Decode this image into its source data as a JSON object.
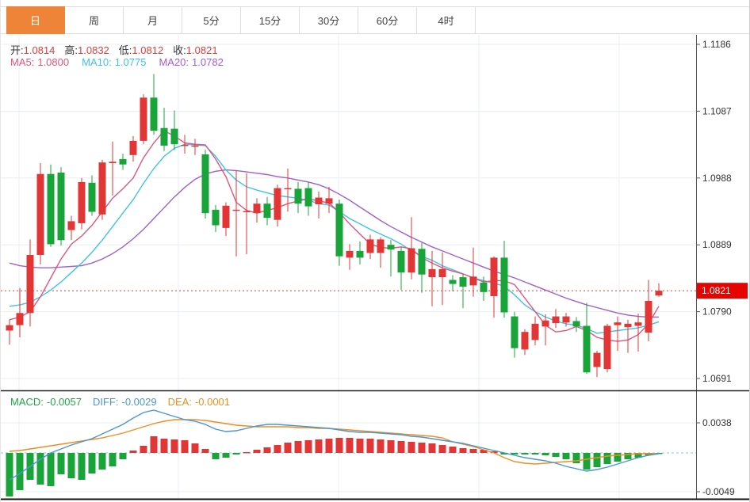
{
  "tabs": [
    {
      "key": "day",
      "label": "日",
      "active": true
    },
    {
      "key": "week",
      "label": "周",
      "active": false
    },
    {
      "key": "month",
      "label": "月",
      "active": false
    },
    {
      "key": "min5",
      "label": "5分",
      "active": false
    },
    {
      "key": "min15",
      "label": "15分",
      "active": false
    },
    {
      "key": "min30",
      "label": "30分",
      "active": false
    },
    {
      "key": "min60",
      "label": "60分",
      "active": false
    },
    {
      "key": "hour4",
      "label": "4时",
      "active": false
    }
  ],
  "legend": {
    "ohlc": [
      {
        "label": "开:",
        "value": "1.0814"
      },
      {
        "label": "高:",
        "value": "1.0832"
      },
      {
        "label": "低:",
        "value": "1.0812"
      },
      {
        "label": "收:",
        "value": "1.0821"
      }
    ],
    "ma": [
      {
        "label": "MA5:",
        "value": "1.0800"
      },
      {
        "label": "MA10:",
        "value": "1.0775"
      },
      {
        "label": "MA20:",
        "value": "1.0782"
      }
    ]
  },
  "macd_legend": [
    {
      "label": "MACD:",
      "value": "-0.0057"
    },
    {
      "label": "DIFF:",
      "value": "-0.0029"
    },
    {
      "label": "DEA:",
      "value": "-0.0001"
    }
  ],
  "colors": {
    "up": "#e23636",
    "down": "#18a438",
    "ma5": "#e0557e",
    "ma10": "#3ec3e8",
    "ma20": "#a35ecb",
    "diff": "#4a96d2",
    "dea": "#ef8d1f",
    "macd_value": "#22a447",
    "price_line": "#e13c39",
    "badge_bg": "#e60400",
    "tab_active_bg": "#ed8437",
    "grid": "#e9eef4",
    "axis_text": "#333333",
    "zero_line": "#90c5e8"
  },
  "chart_data": {
    "type": "candlestick",
    "title": "日线 K线图 (daily candlestick with MA5/MA10/MA20 and MACD)",
    "price_axis": {
      "ticks": [
        1.1186,
        1.1087,
        1.0988,
        1.0889,
        1.079,
        1.0691
      ],
      "range": [
        1.0691,
        1.1186
      ],
      "last_price": 1.0821
    },
    "candles": [
      [
        1.0762,
        1.0778,
        1.0741,
        1.077
      ],
      [
        1.077,
        1.0825,
        1.0752,
        1.0788
      ],
      [
        1.0788,
        1.0897,
        1.0768,
        1.0874
      ],
      [
        1.0874,
        1.101,
        1.086,
        1.0994
      ],
      [
        1.0994,
        1.1008,
        1.0886,
        1.089
      ],
      [
        1.0996,
        1.1004,
        1.0888,
        1.0896
      ],
      [
        1.0911,
        1.0932,
        1.0896,
        1.0924
      ],
      [
        1.0921,
        1.0988,
        1.0912,
        1.0982
      ],
      [
        1.0981,
        1.0992,
        1.0932,
        1.0938
      ],
      [
        1.0934,
        1.1015,
        1.0926,
        1.1011
      ],
      [
        1.101,
        1.1042,
        1.0962,
        1.1012
      ],
      [
        1.1016,
        1.1024,
        1.1,
        1.1008
      ],
      [
        1.1022,
        1.105,
        1.1012,
        1.1043
      ],
      [
        1.1043,
        1.1112,
        1.1038,
        1.1107
      ],
      [
        1.1107,
        1.1142,
        1.1052,
        1.1058
      ],
      [
        1.1062,
        1.1092,
        1.1028,
        1.1036
      ],
      [
        1.1061,
        1.1088,
        1.103,
        1.1038
      ],
      [
        1.1037,
        1.1052,
        1.1024,
        1.1037
      ],
      [
        1.1036,
        1.1046,
        1.1022,
        1.1036
      ],
      [
        1.1023,
        1.103,
        1.0928,
        1.0936
      ],
      [
        1.0941,
        1.0948,
        1.0908,
        1.0918
      ],
      [
        1.0914,
        1.0952,
        1.0902,
        1.0947
      ],
      [
        1.094,
        1.0999,
        1.0872,
        1.0941
      ],
      [
        1.0938,
        1.0995,
        1.0875,
        1.0939
      ],
      [
        1.0936,
        1.0958,
        1.0922,
        1.095
      ],
      [
        1.095,
        1.096,
        1.0918,
        1.0929
      ],
      [
        1.0926,
        1.0978,
        1.0916,
        1.0973
      ],
      [
        1.0972,
        1.1002,
        1.0938,
        1.0973
      ],
      [
        1.0972,
        1.0982,
        1.0936,
        1.095
      ],
      [
        1.0973,
        1.0982,
        1.0932,
        1.0946
      ],
      [
        1.0949,
        1.0968,
        1.0928,
        1.0959
      ],
      [
        1.095,
        1.0975,
        1.0936,
        1.0958
      ],
      [
        1.095,
        1.0956,
        1.0858,
        1.0872
      ],
      [
        1.087,
        1.089,
        1.0852,
        1.088
      ],
      [
        1.088,
        1.0894,
        1.086,
        1.087
      ],
      [
        1.0877,
        1.0904,
        1.0868,
        1.0897
      ],
      [
        1.0877,
        1.09,
        1.0855,
        1.0897
      ],
      [
        1.0889,
        1.0896,
        1.0842,
        1.0882
      ],
      [
        1.088,
        1.0886,
        1.0822,
        1.0848
      ],
      [
        1.0848,
        1.093,
        1.0838,
        1.0884
      ],
      [
        1.0883,
        1.0892,
        1.0818,
        1.0845
      ],
      [
        1.0841,
        1.088,
        1.0798,
        1.0853
      ],
      [
        1.0841,
        1.0878,
        1.08,
        1.0853
      ],
      [
        1.0837,
        1.0844,
        1.082,
        1.0831
      ],
      [
        1.0841,
        1.0846,
        1.0795,
        1.0827
      ],
      [
        1.0829,
        1.0885,
        1.0812,
        1.0842
      ],
      [
        1.0833,
        1.0842,
        1.0806,
        1.0819
      ],
      [
        1.0813,
        1.0872,
        1.0781,
        1.087
      ],
      [
        1.087,
        1.0895,
        1.0781,
        1.0789
      ],
      [
        1.0783,
        1.079,
        1.0722,
        1.0736
      ],
      [
        1.0734,
        1.0764,
        1.0726,
        1.076
      ],
      [
        1.0748,
        1.0783,
        1.074,
        1.0772
      ],
      [
        1.0768,
        1.0786,
        1.074,
        1.0777
      ],
      [
        1.0773,
        1.0794,
        1.0766,
        1.0783
      ],
      [
        1.0774,
        1.0788,
        1.0768,
        1.0783
      ],
      [
        1.0776,
        1.0782,
        1.076,
        1.0768
      ],
      [
        1.0769,
        1.0803,
        1.0698,
        1.07
      ],
      [
        1.0708,
        1.0732,
        1.0693,
        1.0729
      ],
      [
        1.0705,
        1.0772,
        1.07,
        1.0769
      ],
      [
        1.077,
        1.0783,
        1.0732,
        1.0774
      ],
      [
        1.0767,
        1.0778,
        1.0729,
        1.0772
      ],
      [
        1.0769,
        1.0787,
        1.0731,
        1.0774
      ],
      [
        1.0759,
        1.0837,
        1.0746,
        1.0806
      ],
      [
        1.0814,
        1.0832,
        1.0812,
        1.0821
      ]
    ],
    "ma5": [
      1.0778,
      1.0782,
      1.079,
      1.0812,
      1.084,
      1.0868,
      1.089,
      1.0902,
      1.0918,
      1.0938,
      1.0958,
      1.0972,
      1.0988,
      1.1018,
      1.104,
      1.1058,
      1.105,
      1.104,
      1.1038,
      1.1037,
      1.1016,
      1.099,
      1.0952,
      1.094,
      1.0936,
      1.094,
      1.0944,
      1.095,
      1.0954,
      1.0957,
      1.0954,
      1.0951,
      1.0937,
      1.092,
      1.0905,
      1.089,
      1.0885,
      1.0884,
      1.0886,
      1.0883,
      1.087,
      1.0862,
      1.0855,
      1.085,
      1.0846,
      1.084,
      1.0834,
      1.0836,
      1.0836,
      1.083,
      1.081,
      1.079,
      1.077,
      1.076,
      1.0762,
      1.0768,
      1.0762,
      1.0752,
      1.0748,
      1.0746,
      1.0748,
      1.0756,
      1.0772,
      1.0798
    ],
    "ma10": [
      1.0798,
      1.08,
      1.0804,
      1.0812,
      1.0822,
      1.0834,
      1.0848,
      1.0862,
      1.0878,
      1.0896,
      1.0916,
      1.0936,
      1.0956,
      1.098,
      1.1002,
      1.102,
      1.1032,
      1.1038,
      1.1037,
      1.1036,
      1.102,
      1.1,
      1.0985,
      1.0975,
      1.097,
      1.0966,
      1.0962,
      1.096,
      1.0958,
      1.0955,
      1.095,
      1.0948,
      1.0938,
      1.0928,
      1.092,
      1.0912,
      1.0905,
      1.0898,
      1.089,
      1.088,
      1.0872,
      1.0866,
      1.0858,
      1.0852,
      1.0846,
      1.084,
      1.0836,
      1.0832,
      1.0828,
      1.0815,
      1.08,
      1.079,
      1.0782,
      1.0776,
      1.0772,
      1.077,
      1.0765,
      1.0758,
      1.076,
      1.0762,
      1.0764,
      1.0766,
      1.077,
      1.0775
    ],
    "ma20": [
      1.0862,
      1.0858,
      1.0856,
      1.0855,
      1.0855,
      1.0856,
      1.0857,
      1.0858,
      1.0862,
      1.0868,
      1.0876,
      1.0886,
      1.0898,
      1.0912,
      1.0928,
      1.0944,
      1.096,
      1.0974,
      1.0986,
      1.0994,
      1.0998,
      1.1,
      1.0999,
      1.0997,
      1.0995,
      1.0993,
      1.099,
      1.0988,
      1.0985,
      1.0982,
      1.0978,
      1.0972,
      1.0964,
      1.0955,
      1.0945,
      1.0935,
      1.0925,
      1.0916,
      1.0908,
      1.09,
      1.0893,
      1.0886,
      1.088,
      1.0874,
      1.0868,
      1.0862,
      1.0856,
      1.085,
      1.0845,
      1.084,
      1.0834,
      1.0828,
      1.0822,
      1.0816,
      1.081,
      1.0805,
      1.08,
      1.0796,
      1.0792,
      1.0788,
      1.0785,
      1.0783,
      1.0782,
      1.0782
    ],
    "macd": {
      "ticks": [
        0.0038,
        -0.0049
      ],
      "hist": [
        -0.0055,
        -0.0047,
        -0.0034,
        -0.004,
        -0.0042,
        -0.0027,
        -0.0032,
        -0.0034,
        -0.0026,
        -0.0021,
        -0.0017,
        -0.0008,
        0.0003,
        0.0009,
        0.0021,
        0.0018,
        0.0017,
        0.0016,
        0.0012,
        0.0005,
        -0.0008,
        -0.0006,
        -0.0002,
        0.0001,
        0.0004,
        0.0007,
        0.001,
        0.0013,
        0.0015,
        0.0016,
        0.0017,
        0.0018,
        0.0019,
        0.0019,
        0.0018,
        0.0018,
        0.0017,
        0.0016,
        0.0015,
        0.0014,
        0.0013,
        0.0012,
        0.001,
        0.0008,
        0.0006,
        0.0005,
        0.0004,
        0.0002,
        -0.0002,
        -0.0002,
        -0.0002,
        -0.0002,
        -0.0003,
        -0.0005,
        -0.0008,
        -0.0013,
        -0.0021,
        -0.0018,
        -0.0014,
        -0.0011,
        -0.0008,
        -0.0006,
        -0.0003,
        -0.0001
      ],
      "diff": [
        -0.0034,
        -0.0026,
        -0.0017,
        -0.0008,
        0.0,
        0.0005,
        0.001,
        0.0014,
        0.0018,
        0.0024,
        0.003,
        0.0036,
        0.0044,
        0.0051,
        0.0054,
        0.005,
        0.0046,
        0.0042,
        0.004,
        0.0036,
        0.003,
        0.0027,
        0.0028,
        0.0031,
        0.0034,
        0.0036,
        0.0036,
        0.0035,
        0.0034,
        0.0033,
        0.0032,
        0.0031,
        0.0029,
        0.0027,
        0.0026,
        0.0026,
        0.0025,
        0.0024,
        0.0023,
        0.0021,
        0.002,
        0.0018,
        0.0016,
        0.0014,
        0.0012,
        0.0009,
        0.0006,
        0.0003,
        0.0,
        -0.0003,
        -0.0006,
        -0.0008,
        -0.001,
        -0.0013,
        -0.0017,
        -0.002,
        -0.0023,
        -0.0021,
        -0.0018,
        -0.0014,
        -0.001,
        -0.0006,
        -0.0003,
        -0.0001
      ],
      "dea": [
        0.0002,
        0.0003,
        0.0005,
        0.0007,
        0.0009,
        0.0011,
        0.0013,
        0.0015,
        0.0017,
        0.0019,
        0.0022,
        0.0025,
        0.0029,
        0.0033,
        0.0037,
        0.004,
        0.0042,
        0.0042,
        0.0042,
        0.0041,
        0.0039,
        0.0037,
        0.0035,
        0.0034,
        0.0033,
        0.0033,
        0.0033,
        0.0033,
        0.0032,
        0.0032,
        0.0031,
        0.0031,
        0.003,
        0.0029,
        0.0028,
        0.0027,
        0.0026,
        0.0025,
        0.0024,
        0.0023,
        0.0022,
        0.0021,
        0.0019,
        0.0014,
        0.0011,
        0.0008,
        0.0004,
        0.0,
        -0.0006,
        -0.0011,
        -0.0013,
        -0.0014,
        -0.0013,
        -0.0012,
        -0.0011,
        -0.001,
        -0.0008,
        -0.0006,
        -0.0004,
        -0.0003,
        -0.0002,
        -0.0001,
        -0.0001,
        -0.0001
      ]
    }
  }
}
